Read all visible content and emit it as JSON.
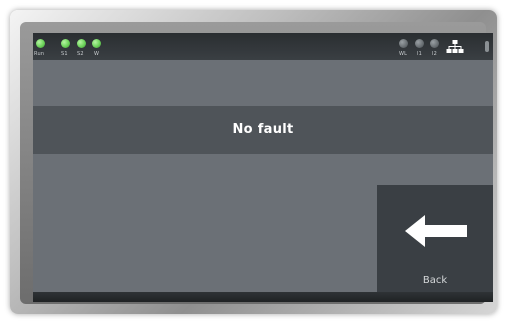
{
  "status_bar": {
    "left_indicators": [
      {
        "label": "Run",
        "on": true
      },
      {
        "label": "S1",
        "on": true
      },
      {
        "label": "S2",
        "on": true
      },
      {
        "label": "W",
        "on": true
      }
    ],
    "right_indicators": [
      {
        "label": "WL",
        "on": false
      },
      {
        "label": "I1",
        "on": false
      },
      {
        "label": "I2",
        "on": false
      }
    ],
    "network_icon": "network-icon",
    "indicator_on_color": "#6cd35a",
    "indicator_off_color": "#5f6569"
  },
  "main": {
    "fault_message": "No fault"
  },
  "back_button": {
    "label": "Back",
    "icon": "arrow-left-icon"
  }
}
